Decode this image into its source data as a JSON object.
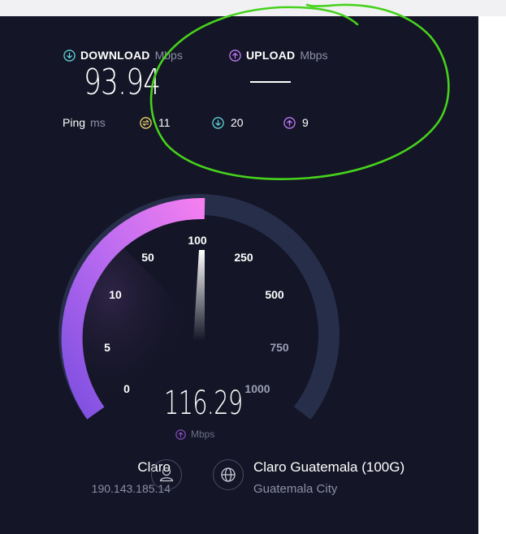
{
  "download": {
    "label": "DOWNLOAD",
    "unit": "Mbps",
    "value": "93.94"
  },
  "upload": {
    "label": "UPLOAD",
    "unit": "Mbps",
    "value": ""
  },
  "ping": {
    "label": "Ping",
    "unit": "ms",
    "idle": "11",
    "download": "20",
    "upload": "9"
  },
  "gauge": {
    "scale_labels": [
      "0",
      "5",
      "10",
      "50",
      "100",
      "250",
      "500",
      "750",
      "1000"
    ],
    "current_speed": "116.29",
    "unit": "Mbps",
    "phase": "upload"
  },
  "isp": {
    "name": "Claro",
    "ip": "190.143.185.14"
  },
  "server": {
    "name": "Claro Guatemala (100G)",
    "city": "Guatemala City"
  },
  "colors": {
    "background": "#141526",
    "download_accent": "#5ed3d8",
    "upload_accent": "#bf7bfa",
    "ping_accent": "#efd86b",
    "gauge_active": "#f17ff1",
    "gauge_track": "#262e4a",
    "annotation": "#46d21c"
  },
  "icons": {
    "download": "arrow-down-circle-icon",
    "upload": "arrow-up-circle-icon",
    "idle_ping": "ping-idle-icon",
    "isp": "user-icon",
    "server": "globe-icon"
  }
}
